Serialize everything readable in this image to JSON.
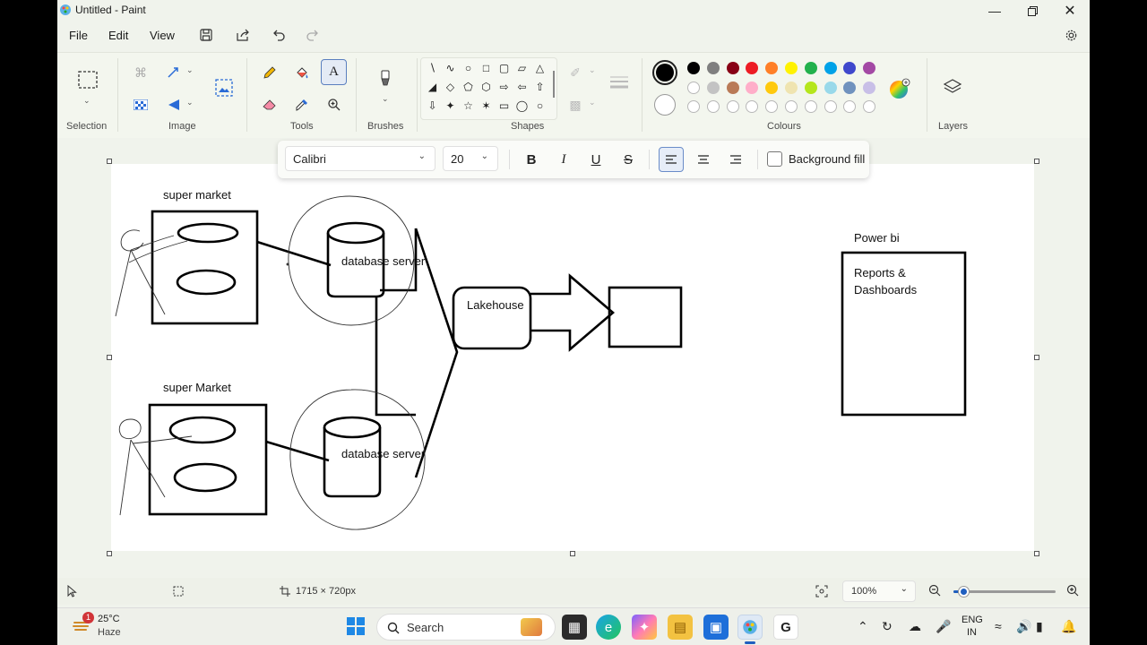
{
  "window": {
    "title": "Untitled - Paint"
  },
  "menu": {
    "items": [
      "File",
      "Edit",
      "View"
    ]
  },
  "ribbon": {
    "groups": {
      "selection": "Selection",
      "image": "Image",
      "tools": "Tools",
      "brushes": "Brushes",
      "shapes": "Shapes",
      "colours": "Colours",
      "layers": "Layers"
    },
    "palette": {
      "primary": "#000000",
      "secondary": "#ffffff",
      "row1": [
        "#000000",
        "#7f7f7f",
        "#880015",
        "#ed1c24",
        "#ff7f27",
        "#fff200",
        "#22b14c",
        "#00a2e8",
        "#3f48cc",
        "#a349a4"
      ],
      "row2": [
        "#ffffff",
        "#c3c3c3",
        "#b97a57",
        "#ffaec9",
        "#ffc90e",
        "#efe4b0",
        "#b5e61d",
        "#99d9ea",
        "#7092be",
        "#c8bfe7"
      ],
      "row3_empty_count": 10
    }
  },
  "text_toolbar": {
    "font_family": "Calibri",
    "font_size": "20",
    "background_fill_label": "Background fill",
    "background_fill_checked": false
  },
  "canvas": {
    "labels": {
      "store_top": "super market",
      "store_bottom": "super Market",
      "db_top": "database server",
      "db_bottom": "database server",
      "lakehouse": "Lakehouse",
      "powerbi": "Power bi",
      "reports_line1": "Reports &",
      "reports_line2": "Dashboards"
    }
  },
  "statusbar": {
    "canvas_size": "1715 × 720px",
    "zoom": "100%",
    "zoom_slider_fraction": 0.1
  },
  "taskbar": {
    "weather_temp": "25°C",
    "weather_desc": "Haze",
    "weather_badge": "1",
    "search_label": "Search",
    "lang_line1": "ENG",
    "lang_line2": "IN"
  }
}
